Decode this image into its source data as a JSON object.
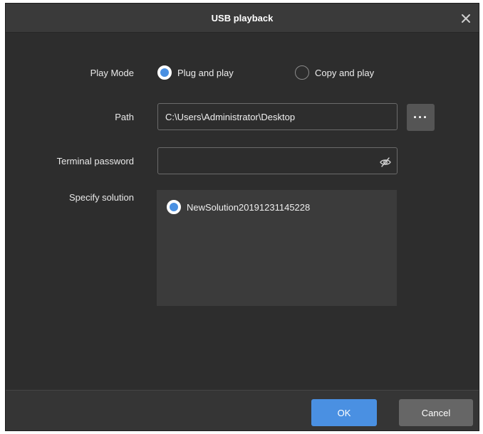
{
  "dialog": {
    "title": "USB playback",
    "close_icon": "close-icon"
  },
  "play_mode": {
    "label": "Play Mode",
    "options": [
      {
        "label": "Plug and play",
        "checked": true
      },
      {
        "label": "Copy and play",
        "checked": false
      }
    ]
  },
  "path": {
    "label": "Path",
    "value": "C:\\Users\\Administrator\\Desktop",
    "browse_label": "···"
  },
  "terminal_password": {
    "label": "Terminal password",
    "value": "",
    "icon": "eye-hidden-icon"
  },
  "specify_solution": {
    "label": "Specify solution",
    "items": [
      {
        "label": "NewSolution20191231145228",
        "checked": true
      }
    ]
  },
  "footer": {
    "ok_label": "OK",
    "cancel_label": "Cancel"
  },
  "colors": {
    "accent": "#4a90e2",
    "background": "#2d2d2d",
    "titlebar": "#3a3a3a",
    "cancel_button": "#666666"
  }
}
